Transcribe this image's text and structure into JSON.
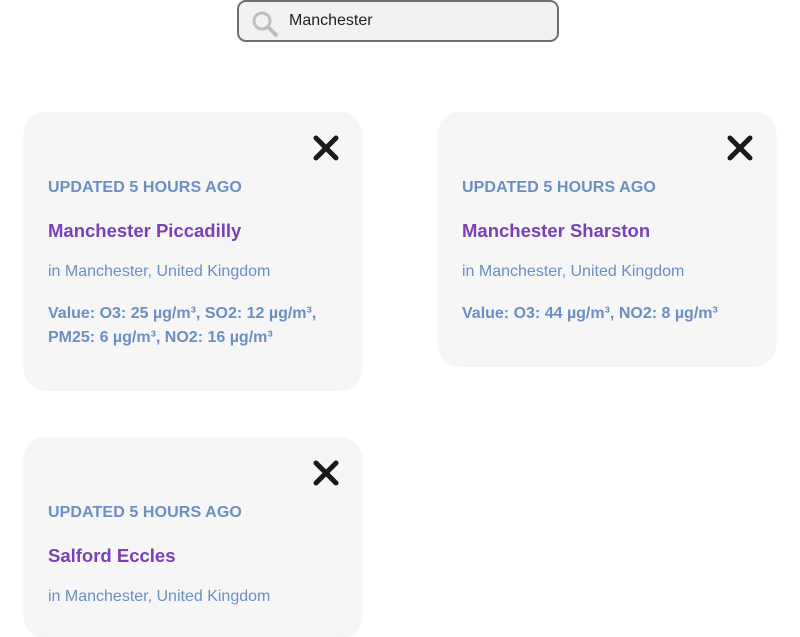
{
  "search": {
    "value": "Manchester",
    "icon": "search-icon"
  },
  "colors": {
    "updated_text": "#6b8fc2",
    "station_name": "#7b3fb6",
    "card_background": "#f6f6f6",
    "close_icon": "#1a1a1a"
  },
  "cards": [
    {
      "updated": "UPDATED 5 HOURS AGO",
      "name": "Manchester Piccadilly",
      "location": "in Manchester, United Kingdom",
      "values": "Value: O3: 25 µg/m³, SO2: 12 µg/m³, PM25: 6 µg/m³, NO2: 16 µg/m³",
      "close_icon": "close-icon"
    },
    {
      "updated": "UPDATED 5 HOURS AGO",
      "name": "Manchester Sharston",
      "location": "in Manchester, United Kingdom",
      "values": "Value: O3: 44 µg/m³, NO2: 8 µg/m³",
      "close_icon": "close-icon"
    },
    {
      "updated": "UPDATED 5 HOURS AGO",
      "name": "Salford Eccles",
      "location": "in Manchester, United Kingdom",
      "values": "",
      "close_icon": "close-icon"
    }
  ]
}
